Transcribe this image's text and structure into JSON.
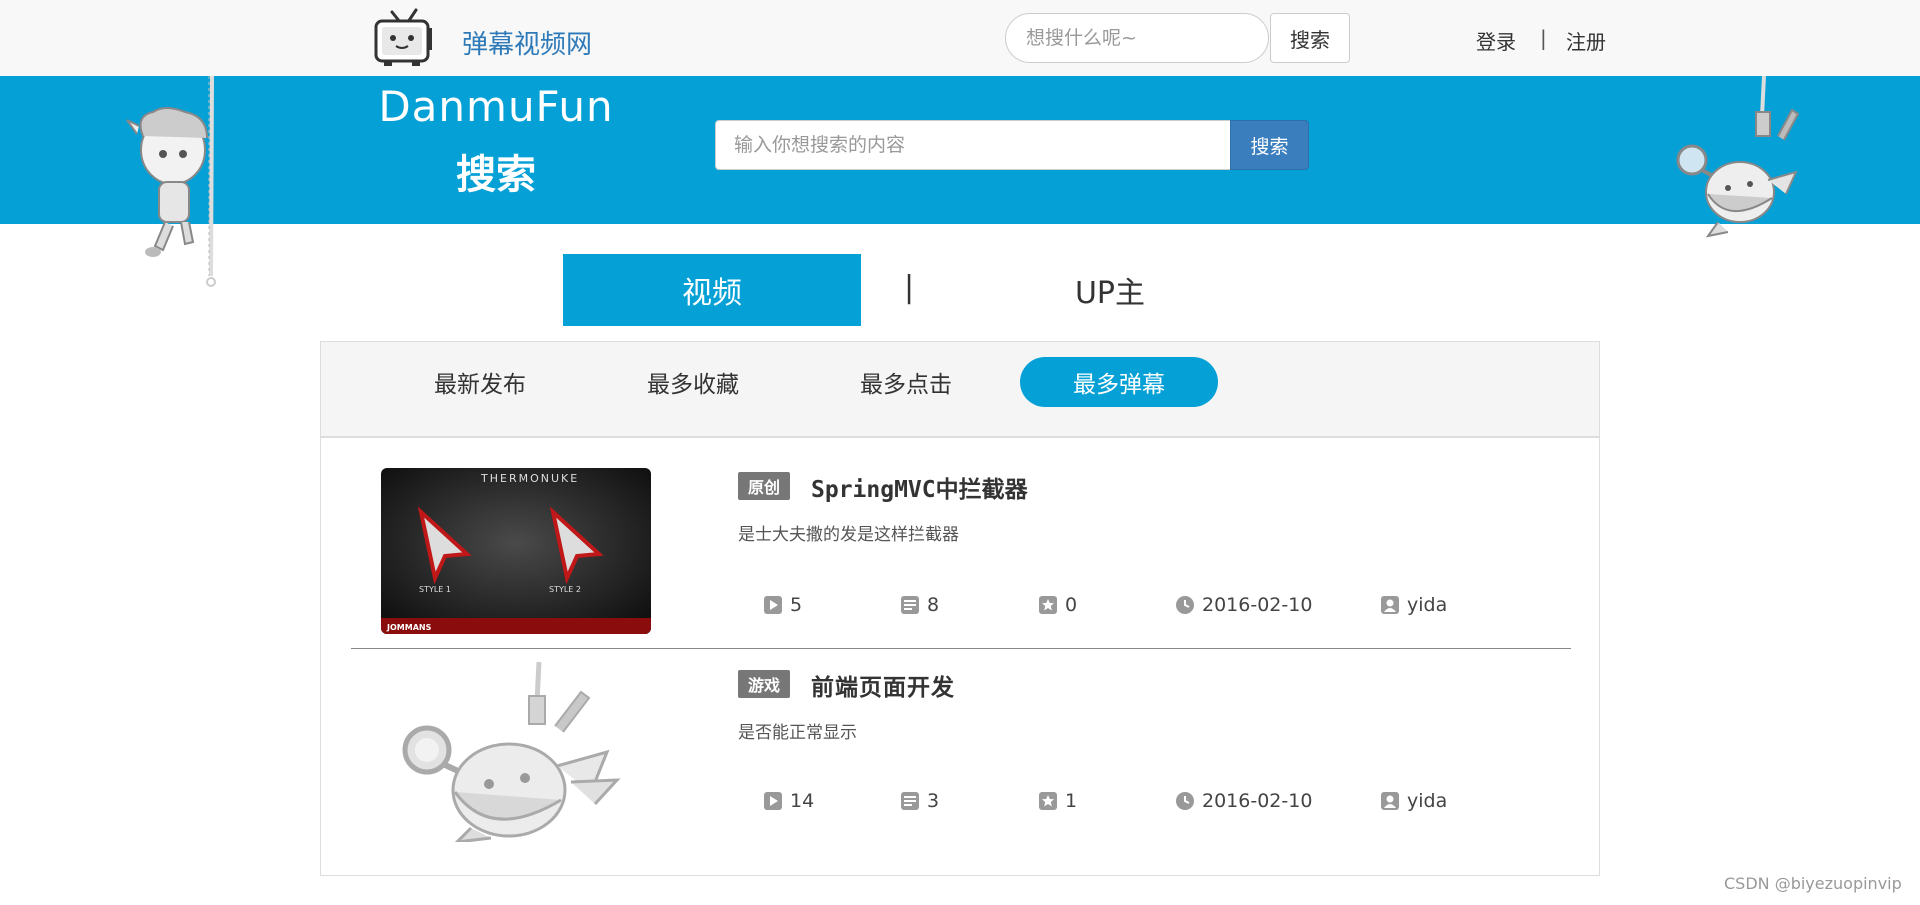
{
  "header": {
    "site_name": "弹幕视频网",
    "search_placeholder": "想搜什么呢~",
    "search_button": "搜索",
    "login": "登录",
    "separator": "|",
    "register": "注册"
  },
  "banner": {
    "brand_main": "DanmuFun",
    "brand_sub": "搜索",
    "search_placeholder": "输入你想搜索的内容",
    "search_button": "搜索"
  },
  "category_tabs": {
    "video": "视频",
    "separator": "|",
    "up": "UP主",
    "active": "video"
  },
  "sort_tabs": [
    {
      "label": "最新发布",
      "active": false
    },
    {
      "label": "最多收藏",
      "active": false
    },
    {
      "label": "最多点击",
      "active": false
    },
    {
      "label": "最多弹幕",
      "active": true
    }
  ],
  "videos": [
    {
      "tag": "原创",
      "title": "SpringMVC中拦截器",
      "description": "是士大夫撒的发是这样拦截器",
      "thumbnail_text": {
        "top": "THERMONUKE",
        "style1": "STYLE 1",
        "style2": "STYLE 2",
        "brand": "JOMMANS"
      },
      "plays": "5",
      "danmu": "8",
      "favorites": "0",
      "date": "2016-02-10",
      "author": "yida"
    },
    {
      "tag": "游戏",
      "title": "前端页面开发",
      "description": "是否能正常显示",
      "plays": "14",
      "danmu": "3",
      "favorites": "1",
      "date": "2016-02-10",
      "author": "yida"
    }
  ],
  "watermark": "CSDN @biyezuopinvip",
  "colors": {
    "primary": "#04a0d6",
    "button_blue": "#3a7ebd",
    "site_name": "#2e7ab8",
    "tag_bg": "#777777"
  }
}
